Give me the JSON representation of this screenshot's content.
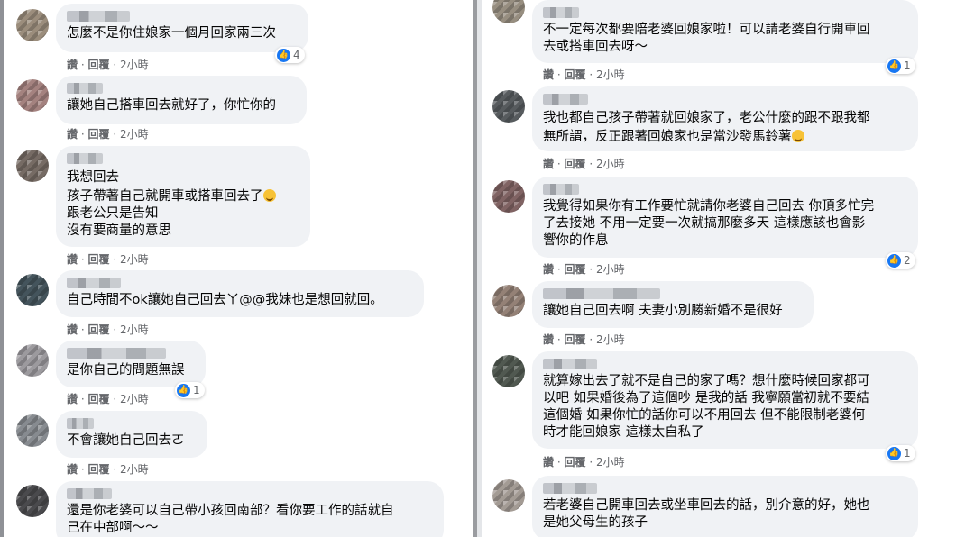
{
  "left_comments": [
    {
      "text": "怎麼不是你住娘家一個月回家兩三次",
      "like": "讚",
      "reply": "回覆",
      "time": "2小時",
      "reactions": "4"
    },
    {
      "text": "讓她自己搭車回去就好了，你忙你的",
      "like": "讚",
      "reply": "回覆",
      "time": "2小時",
      "reactions": ""
    },
    {
      "text": "我想回去\n孩子帶著自己就開車或搭車回去了",
      "text2": "跟老公只是告知\n沒有要商量的意思",
      "like": "讚",
      "reply": "回覆",
      "time": "2小時",
      "reactions": ""
    },
    {
      "text": "自己時間不ok讓她自己回去ㄚ@@我妹也是想回就回。",
      "like": "讚",
      "reply": "回覆",
      "time": "2小時",
      "reactions": ""
    },
    {
      "text": "是你自己的問題無誤",
      "like": "讚",
      "reply": "回覆",
      "time": "2小時",
      "reactions": "1"
    },
    {
      "text": "不會讓她自己回去ㄛ",
      "like": "讚",
      "reply": "回覆",
      "time": "2小時",
      "reactions": ""
    },
    {
      "text": "還是你老婆可以自己帶小孩回南部？看你要工作的話就自\n己在中部啊～～",
      "like": "",
      "reply": "",
      "time": "",
      "reactions": ""
    }
  ],
  "right_comments": [
    {
      "text": "不一定每次都要陪老婆回娘家啦！可以請老婆自行開車回\n去或搭車回去呀～",
      "like": "讚",
      "reply": "回覆",
      "time": "2小時",
      "reactions": "1"
    },
    {
      "text": "我也都自己孩子帶著就回娘家了，老公什麼的跟不跟我都\n無所謂，反正跟著回娘家也是當沙發馬鈴薯",
      "like": "讚",
      "reply": "回覆",
      "time": "2小時",
      "reactions": ""
    },
    {
      "text": "我覺得如果你有工作要忙就請你老婆自己回去 你頂多忙完\n了去接她 不用一定要一次就搞那麼多天 這樣應該也會影\n響你的作息",
      "like": "讚",
      "reply": "回覆",
      "time": "2小時",
      "reactions": "2"
    },
    {
      "text": "讓她自己回去啊 夫妻小別勝新婚不是很好",
      "like": "讚",
      "reply": "回覆",
      "time": "2小時",
      "reactions": ""
    },
    {
      "text": "就算嫁出去了就不是自己的家了嗎？想什麼時候回家都可\n以吧 如果婚後為了這個吵 是我的話 我寧願當初就不要結\n這個婚 如果你忙的話你可以不用回去 但不能限制老婆何\n時才能回娘家 這樣太自私了",
      "like": "讚",
      "reply": "回覆",
      "time": "2小時",
      "reactions": "1"
    },
    {
      "text": "若老婆自己開車回去或坐車回去的話，別介意的好，她也\n是她父母生的孩子",
      "like": "",
      "reply": "",
      "time": "",
      "reactions": ""
    }
  ],
  "sep": "·",
  "colors": {
    "bubble": "#f0f2f5",
    "meta": "#65676b",
    "like_blue": "#1877f2"
  },
  "icons": {
    "like": "thumbs-up-icon",
    "emoji": "laughing-emoji-icon"
  }
}
